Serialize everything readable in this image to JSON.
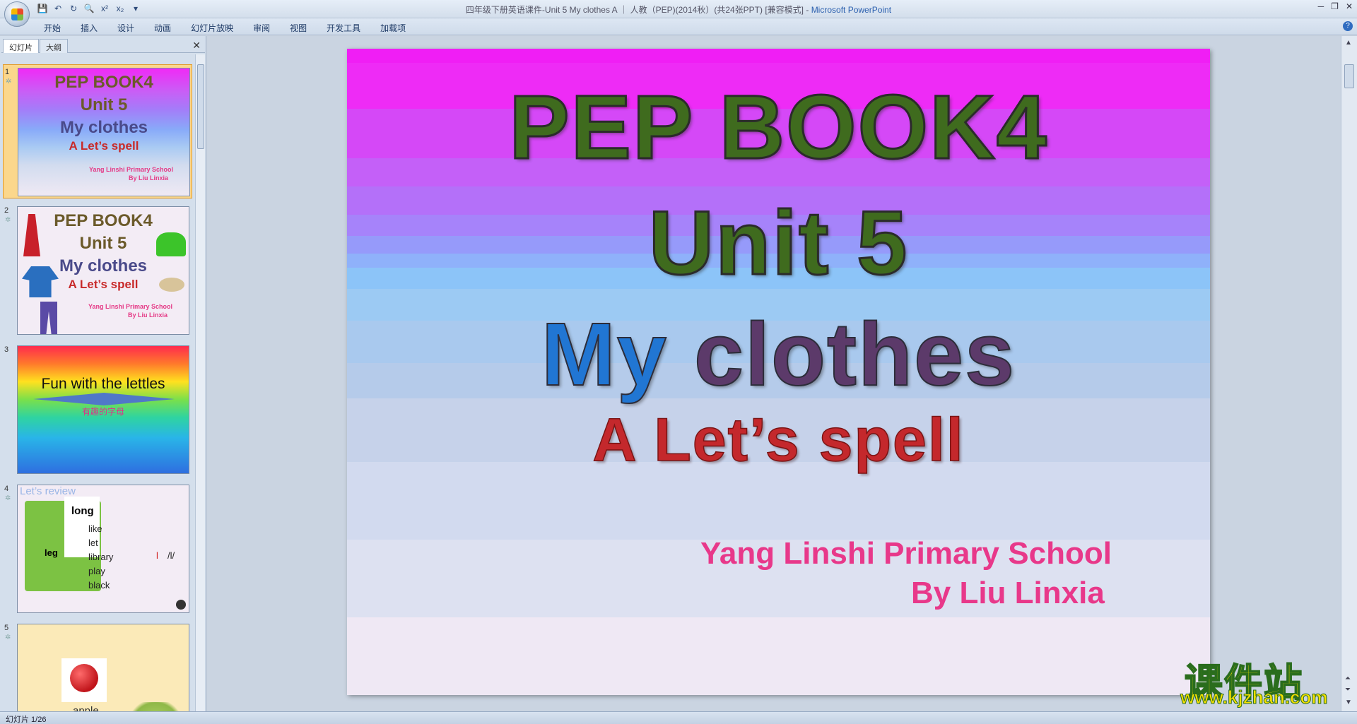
{
  "window": {
    "title_doc": "四年级下册英语课件-Unit 5 My clothes A ｜ 人教（PEP)(2014秋）(共24张PPT) [兼容模式]",
    "title_sep": " - ",
    "title_app": "Microsoft PowerPoint"
  },
  "quick_access": {
    "icons": [
      "save-icon",
      "undo-icon",
      "redo-icon",
      "print-preview-icon",
      "superscript-icon",
      "subscript-icon",
      "customize-icon"
    ],
    "superscript_label": "x²",
    "subscript_label": "x₂"
  },
  "ribbon": {
    "tabs": [
      "开始",
      "插入",
      "设计",
      "动画",
      "幻灯片放映",
      "审阅",
      "视图",
      "开发工具",
      "加载项"
    ]
  },
  "left_pane": {
    "tab_slides": "幻灯片",
    "tab_outline": "大纲",
    "close": "✕",
    "thumbnails": [
      {
        "num": "1",
        "lines": [
          "PEP BOOK4",
          "Unit 5",
          "My clothes",
          "A Let’s spell"
        ],
        "school": "Yang Linshi Primary School",
        "author": "By Liu Linxia"
      },
      {
        "num": "2",
        "lines": [
          "PEP BOOK4",
          "Unit 5",
          "My clothes",
          "A Let’s spell"
        ],
        "school": "Yang Linshi Primary School",
        "author": "By Liu Linxia"
      },
      {
        "num": "3",
        "title": "Fun with the lettles",
        "subtitle": "有趣的字母"
      },
      {
        "num": "4",
        "heading": "Let’s review",
        "word_long": "long",
        "word_leg": "leg",
        "words": [
          "like",
          "let",
          "library",
          "play",
          "black"
        ],
        "letter": "l",
        "phonetic": "/l/"
      },
      {
        "num": "5",
        "word": "apple"
      }
    ]
  },
  "slide": {
    "title": "PEP BOOK4",
    "unit": "Unit 5",
    "my": "My",
    "clothes": "clothes",
    "spell": "A Let’s spell",
    "school": "Yang Linshi Primary School",
    "author": "By Liu Linxia"
  },
  "watermark": {
    "cn": "课件站",
    "url": "www.kjzhan.com"
  },
  "status": {
    "slide_counter": "幻灯片 1/26"
  },
  "colors": {
    "title_green": "#3f6b1e",
    "my_blue": "#2176d3",
    "clothes_purple": "#5c3a6a",
    "spell_red": "#c4282c",
    "school_pink": "#e8388a"
  }
}
